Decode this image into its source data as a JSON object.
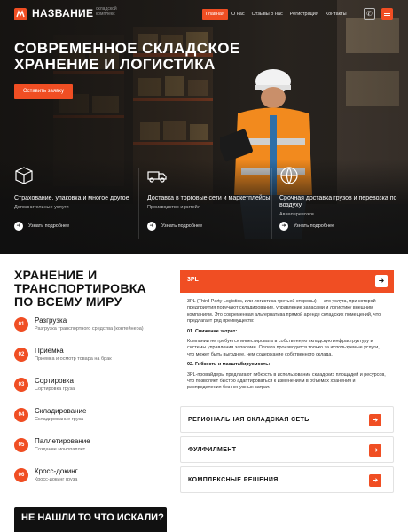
{
  "header": {
    "logo_text": "НАЗВАНИЕ",
    "logo_sub": "складской комплекс",
    "nav": [
      {
        "label": "Главная",
        "active": true
      },
      {
        "label": "О нас",
        "active": false
      },
      {
        "label": "Отзывы о нас",
        "active": false
      },
      {
        "label": "Регистрация",
        "active": false
      },
      {
        "label": "Контакты",
        "active": false
      }
    ],
    "phone_icon": "phone-icon",
    "menu_icon": "hamburger-icon"
  },
  "hero": {
    "title": "Современное складское хранение и логистика",
    "cta": "Оставить заявку",
    "features": [
      {
        "icon": "box-icon",
        "title": "Страхование, упаковка и многое другое",
        "subtitle": "Дополнительные услуги",
        "link": "Узнать подробнее"
      },
      {
        "icon": "truck-icon",
        "title": "Доставка в торговые сети и маркетплейсы",
        "subtitle": "Производство и ритейл",
        "link": "Узнать подробнее"
      },
      {
        "icon": "globe-icon",
        "title": "Срочная доставка грузов и перевозка по воздуху",
        "subtitle": "Авиаперевозки",
        "link": "Узнать подробнее"
      }
    ]
  },
  "services": {
    "title": "Хранение и транспортировка по всему миру",
    "steps": [
      {
        "num": "01",
        "title": "Разгрузка",
        "subtitle": "Разгрузка транспортного средства (контейнера)"
      },
      {
        "num": "02",
        "title": "Приемка",
        "subtitle": "Приемка и осмотр товара на брак"
      },
      {
        "num": "03",
        "title": "Сортировка",
        "subtitle": "Сортировка груза"
      },
      {
        "num": "04",
        "title": "Складирование",
        "subtitle": "Складирование груза"
      },
      {
        "num": "05",
        "title": "Паллетирование",
        "subtitle": "Создание монопаллет"
      },
      {
        "num": "06",
        "title": "Кросс-докинг",
        "subtitle": "Кросс-докинг груза"
      }
    ],
    "dark_box_title": "Не нашли то что искали?"
  },
  "panels": {
    "open": {
      "title": "3PL",
      "intro": "3PL (Third-Party Logistics, или логистика третьей стороны) — это услуга, при которой предприятия поручают складирование, управление запасами и логистику внешним компаниям. Это современная альтернатива прямой аренде складских помещений, что предлагает ряд преимуществ:",
      "point1_title": "01. Снижение затрат:",
      "point1_text": "Компании не требуется инвестировать в собственную складскую инфраструктуру и системы управления запасами. Оплата производится только за используемые услуги, что может быть выгоднее, чем содержание собственного склада.",
      "point2_title": "02. Гибкость и масштабируемость:",
      "point2_text": "3PL-провайдеры предлагают гибкость в использовании складских площадей и ресурсов, что позволяет быстро адаптироваться к изменениям в объемах хранения и распределения без ненужных затрат."
    },
    "closed": [
      {
        "title": "Региональная складская сеть"
      },
      {
        "title": "Фулфилмент"
      },
      {
        "title": "Комплексные решения"
      }
    ]
  },
  "colors": {
    "accent": "#f04e23",
    "dark": "#111111"
  }
}
